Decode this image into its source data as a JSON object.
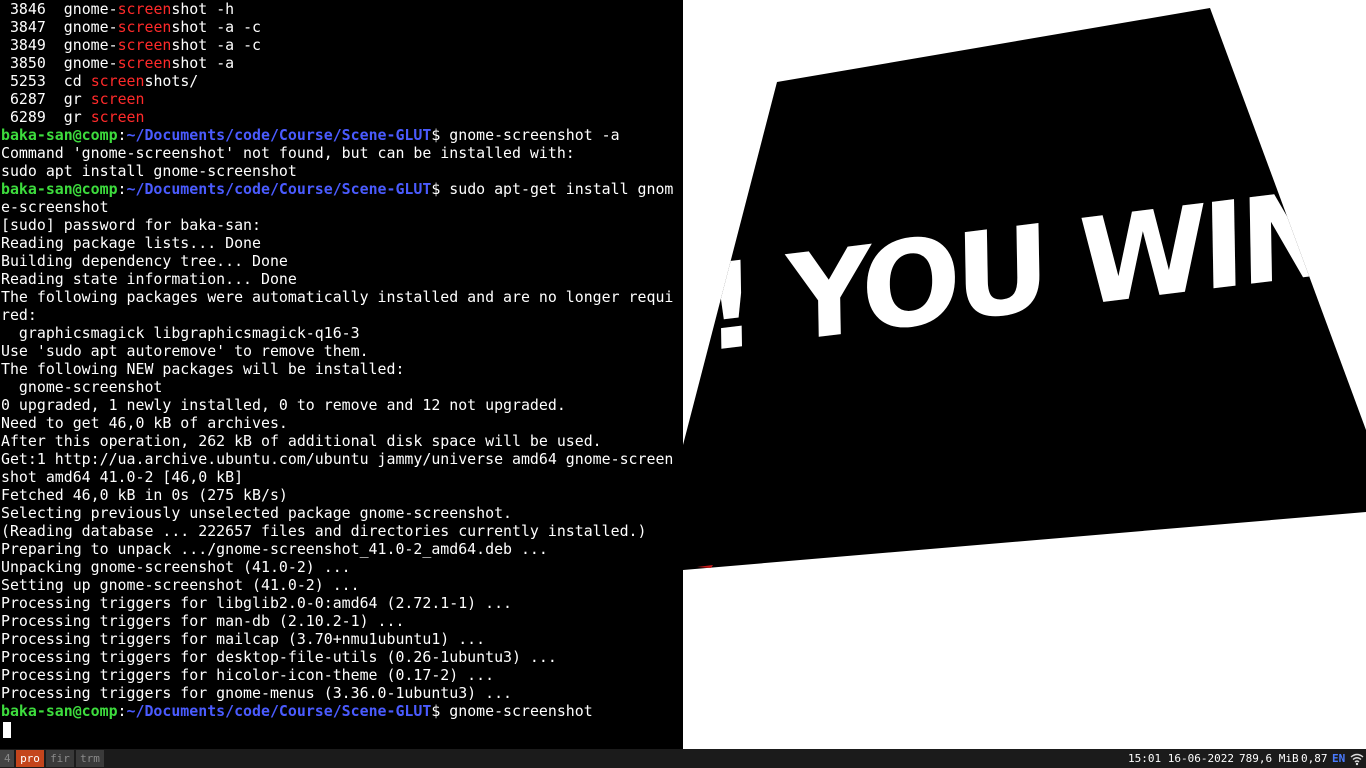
{
  "terminal": {
    "history": [
      {
        "num": "3846",
        "pre": "gnome-",
        "hl": "screen",
        "post": "shot -h"
      },
      {
        "num": "3847",
        "pre": "gnome-",
        "hl": "screen",
        "post": "shot -a -c"
      },
      {
        "num": "3849",
        "pre": "gnome-",
        "hl": "screen",
        "post": "shot -a -c"
      },
      {
        "num": "3850",
        "pre": "gnome-",
        "hl": "screen",
        "post": "shot -a"
      },
      {
        "num": "5253",
        "pre": "cd ",
        "hl": "screen",
        "post": "shots/"
      },
      {
        "num": "6287",
        "pre": "gr ",
        "hl": "screen",
        "post": ""
      },
      {
        "num": "6289",
        "pre": "gr ",
        "hl": "screen",
        "post": ""
      }
    ],
    "prompt_user": "baka-san@comp",
    "prompt_sep": ":",
    "prompt_path": "~/Documents/code/Course/Scene-GLUT",
    "prompt_dollar": "$ ",
    "cmd1": "gnome-screenshot -a",
    "out1": [
      "Command 'gnome-screenshot' not found, but can be installed with:",
      "sudo apt install gnome-screenshot"
    ],
    "cmd2": "sudo apt-get install gnom",
    "out2": [
      "e-screenshot",
      "[sudo] password for baka-san:",
      "Reading package lists... Done",
      "Building dependency tree... Done",
      "Reading state information... Done",
      "The following packages were automatically installed and are no longer requi",
      "red:",
      "  graphicsmagick libgraphicsmagick-q16-3",
      "Use 'sudo apt autoremove' to remove them.",
      "The following NEW packages will be installed:",
      "  gnome-screenshot",
      "0 upgraded, 1 newly installed, 0 to remove and 12 not upgraded.",
      "Need to get 46,0 kB of archives.",
      "After this operation, 262 kB of additional disk space will be used.",
      "Get:1 http://ua.archive.ubuntu.com/ubuntu jammy/universe amd64 gnome-screen",
      "shot amd64 41.0-2 [46,0 kB]",
      "Fetched 46,0 kB in 0s (275 kB/s)",
      "Selecting previously unselected package gnome-screenshot.",
      "(Reading database ... 222657 files and directories currently installed.)",
      "Preparing to unpack .../gnome-screenshot_41.0-2_amd64.deb ...",
      "Unpacking gnome-screenshot (41.0-2) ...",
      "Setting up gnome-screenshot (41.0-2) ...",
      "Processing triggers for libglib2.0-0:amd64 (2.72.1-1) ...",
      "Processing triggers for man-db (2.10.2-1) ...",
      "Processing triggers for mailcap (3.70+nmu1ubuntu1) ...",
      "Processing triggers for desktop-file-utils (0.26-1ubuntu3) ...",
      "Processing triggers for hicolor-icon-theme (0.17-2) ...",
      "Processing triggers for gnome-menus (3.36.0-1ubuntu3) ..."
    ],
    "cmd3": "gnome-screenshot"
  },
  "glut_scene": {
    "banner_text": "N! YOU WIN",
    "background_color": "#ffffff",
    "quad_color": "#000000",
    "text_color": "#ffffff"
  },
  "statusbar": {
    "workspace_num": "4",
    "workspaces": [
      "pro",
      "fir",
      "trm"
    ],
    "active_workspace": "pro",
    "datetime": "15:01 16-06-2022",
    "memory": "789,6 MiB",
    "load": "0,87",
    "language": "EN",
    "wifi_icon": "wifi-icon"
  }
}
